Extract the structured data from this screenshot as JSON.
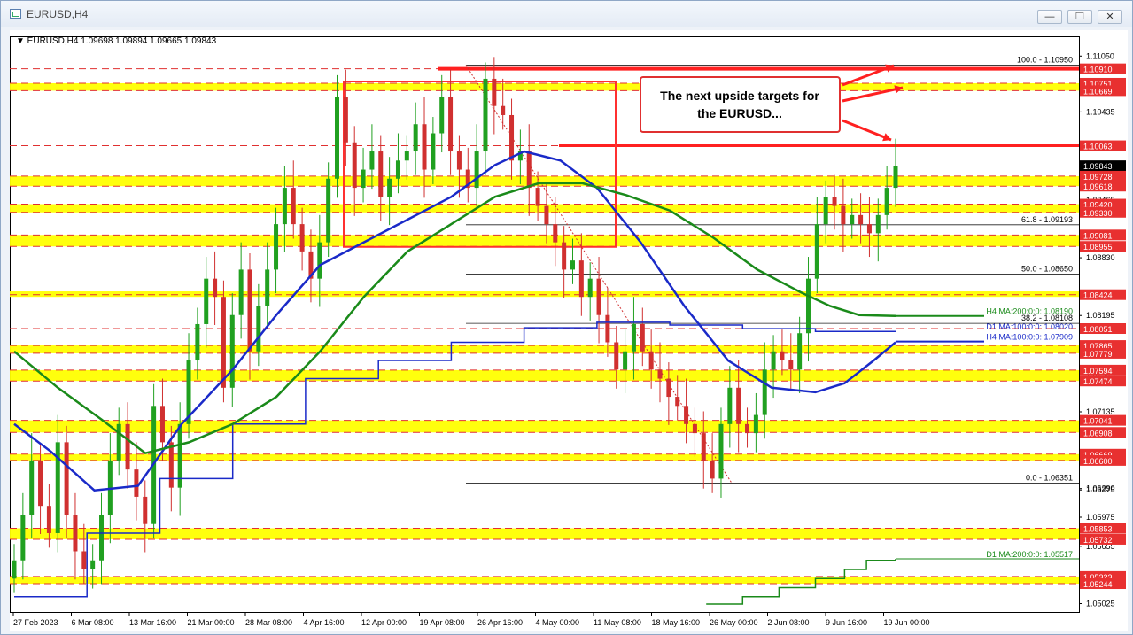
{
  "window": {
    "title": "EURUSD,H4",
    "controls": {
      "minimize": "—",
      "restore": "❐",
      "close": "✕"
    }
  },
  "chart_info": "EURUSD,H4  1.09698 1.09894 1.09665 1.09843",
  "annotation": {
    "line1": "The next upside targets for",
    "line2": "the EURUSD..."
  },
  "colors": {
    "bull": "#20a020",
    "bear": "#d03030",
    "ma100": "#1a2ac8",
    "ma200": "#1a8a1a",
    "d1ma100": "#1a2ac8",
    "d1ma200": "#1a8a1a",
    "zone": "#ffff00",
    "box": "#ff3030",
    "price_label": "#e83030"
  },
  "chart_data": {
    "type": "candlestick",
    "symbol": "EURUSD",
    "timeframe": "H4",
    "ohlc_last": {
      "open": 1.09698,
      "high": 1.09894,
      "low": 1.09665,
      "close": 1.09843
    },
    "ylim": [
      1.0502,
      1.1116
    ],
    "y_ticks": [
      "1.11050",
      "1.10435",
      "1.09845",
      "1.09465",
      "1.08830",
      "1.08195",
      "1.07545",
      "1.06275",
      "1.05975",
      "1.05655",
      "1.05025",
      "1.05290",
      "1.10045",
      "1.07135",
      "1.06290"
    ],
    "x_ticks": [
      "27 Feb 2023",
      "6 Mar 08:00",
      "13 Mar 16:00",
      "21 Mar 00:00",
      "28 Mar 08:00",
      "4 Apr 16:00",
      "12 Apr 00:00",
      "19 Apr 08:00",
      "26 Apr 16:00",
      "4 May 00:00",
      "11 May 08:00",
      "18 May 16:00",
      "26 May 00:00",
      "2 Jun 08:00",
      "9 Jun 16:00",
      "19 Jun 00:00"
    ],
    "price_labels": [
      {
        "text": "1.10910",
        "y": 1.1091,
        "style": "red"
      },
      {
        "text": "1.10751",
        "y": 1.10751,
        "style": "red"
      },
      {
        "text": "1.10669",
        "y": 1.10669,
        "style": "red"
      },
      {
        "text": "1.10063",
        "y": 1.10063,
        "style": "red"
      },
      {
        "text": "1.09843",
        "y": 1.09843,
        "style": "black"
      },
      {
        "text": "1.09728",
        "y": 1.09728,
        "style": "red"
      },
      {
        "text": "1.09618",
        "y": 1.09618,
        "style": "red"
      },
      {
        "text": "1.09420",
        "y": 1.0942,
        "style": "red"
      },
      {
        "text": "1.09330",
        "y": 1.0933,
        "style": "red"
      },
      {
        "text": "1.09081",
        "y": 1.09081,
        "style": "red"
      },
      {
        "text": "1.08955",
        "y": 1.08955,
        "style": "red"
      },
      {
        "text": "1.08424",
        "y": 1.08424,
        "style": "red"
      },
      {
        "text": "1.08051",
        "y": 1.08051,
        "style": "red"
      },
      {
        "text": "1.07865",
        "y": 1.07865,
        "style": "red"
      },
      {
        "text": "1.07779",
        "y": 1.07779,
        "style": "red"
      },
      {
        "text": "1.07594",
        "y": 1.07594,
        "style": "red"
      },
      {
        "text": "1.07474",
        "y": 1.07474,
        "style": "red"
      },
      {
        "text": "1.07041",
        "y": 1.07041,
        "style": "red"
      },
      {
        "text": "1.06908",
        "y": 1.06908,
        "style": "red"
      },
      {
        "text": "1.06669",
        "y": 1.06669,
        "style": "red"
      },
      {
        "text": "1.06600",
        "y": 1.066,
        "style": "red"
      },
      {
        "text": "1.05853",
        "y": 1.05853,
        "style": "red"
      },
      {
        "text": "1.05732",
        "y": 1.05732,
        "style": "red"
      },
      {
        "text": "1.05323",
        "y": 1.05323,
        "style": "red"
      },
      {
        "text": "1.05244",
        "y": 1.05244,
        "style": "red"
      }
    ],
    "fib_labels": [
      {
        "text": "100.0 - 1.10950",
        "y": 1.1095
      },
      {
        "text": "61.8 - 1.09193",
        "y": 1.09193
      },
      {
        "text": "50.0 - 1.08650",
        "y": 1.0865
      },
      {
        "text": "38.2 - 1.08108",
        "y": 1.08108
      },
      {
        "text": "0.0 - 1.06351",
        "y": 1.06351
      }
    ],
    "ma_labels": [
      {
        "text": "H4 MA:200:0:0: 1.08190",
        "y": 1.0819,
        "color": "green"
      },
      {
        "text": "D1 MA:100:0:0: 1.08020",
        "y": 1.0802,
        "color": "blue"
      },
      {
        "text": "H4 MA:100:0:0: 1.07909",
        "y": 1.07909,
        "color": "blue"
      },
      {
        "text": "D1 MA:200:0:0: 1.05517",
        "y": 1.05517,
        "color": "green"
      }
    ],
    "zones": [
      {
        "lo": 1.10669,
        "hi": 1.10751
      },
      {
        "lo": 1.09618,
        "hi": 1.09728
      },
      {
        "lo": 1.0933,
        "hi": 1.0942
      },
      {
        "lo": 1.08955,
        "hi": 1.09081
      },
      {
        "lo": 1.084,
        "hi": 1.0846
      },
      {
        "lo": 1.07779,
        "hi": 1.07865
      },
      {
        "lo": 1.07474,
        "hi": 1.07594
      },
      {
        "lo": 1.06908,
        "hi": 1.07041
      },
      {
        "lo": 1.066,
        "hi": 1.06669
      },
      {
        "lo": 1.05732,
        "hi": 1.05853
      },
      {
        "lo": 1.05244,
        "hi": 1.05323
      }
    ],
    "box": {
      "x_from": "10 Apr",
      "x_to": "9 May",
      "lo": 1.0895,
      "hi": 1.1077
    },
    "ma_h4_100": [
      [
        0,
        1.07
      ],
      [
        5,
        1.067
      ],
      [
        11,
        1.0627
      ],
      [
        17,
        1.0632
      ],
      [
        23,
        1.07
      ],
      [
        30,
        1.076
      ],
      [
        36,
        1.082
      ],
      [
        42,
        1.0875
      ],
      [
        48,
        1.09
      ],
      [
        54,
        1.0925
      ],
      [
        60,
        1.095
      ],
      [
        66,
        1.0985
      ],
      [
        70,
        1.1
      ],
      [
        75,
        1.099
      ],
      [
        80,
        1.096
      ],
      [
        86,
        1.09
      ],
      [
        92,
        1.083
      ],
      [
        98,
        1.077
      ],
      [
        104,
        1.074
      ],
      [
        110,
        1.0735
      ],
      [
        114,
        1.0745
      ],
      [
        118,
        1.077
      ],
      [
        121,
        1.079
      ]
    ],
    "ma_h4_200": [
      [
        0,
        1.078
      ],
      [
        6,
        1.074
      ],
      [
        12,
        1.0705
      ],
      [
        18,
        1.0668
      ],
      [
        24,
        1.068
      ],
      [
        30,
        1.07
      ],
      [
        36,
        1.073
      ],
      [
        42,
        1.078
      ],
      [
        48,
        1.084
      ],
      [
        54,
        1.089
      ],
      [
        60,
        1.092
      ],
      [
        66,
        1.095
      ],
      [
        72,
        1.0965
      ],
      [
        78,
        1.0965
      ],
      [
        84,
        1.0952
      ],
      [
        90,
        1.0935
      ],
      [
        96,
        1.0905
      ],
      [
        102,
        1.087
      ],
      [
        108,
        1.0845
      ],
      [
        112,
        1.083
      ],
      [
        116,
        1.082
      ],
      [
        121,
        1.0819
      ]
    ],
    "ma_d1_100": [
      [
        0,
        1.051
      ],
      [
        10,
        1.058
      ],
      [
        20,
        1.064
      ],
      [
        30,
        1.07
      ],
      [
        40,
        1.075
      ],
      [
        50,
        1.077
      ],
      [
        60,
        1.079
      ],
      [
        70,
        1.0806
      ],
      [
        80,
        1.0812
      ],
      [
        90,
        1.0809
      ],
      [
        100,
        1.0805
      ],
      [
        110,
        1.0802
      ],
      [
        121,
        1.0802
      ]
    ],
    "ma_d1_200": [
      [
        95,
        1.0502
      ],
      [
        100,
        1.051
      ],
      [
        105,
        1.052
      ],
      [
        110,
        1.053
      ],
      [
        114,
        1.054
      ],
      [
        117,
        1.055
      ],
      [
        121,
        1.05517
      ]
    ],
    "closes": [
      1.055,
      1.06,
      1.066,
      1.061,
      1.058,
      1.068,
      1.06,
      1.056,
      1.054,
      1.055,
      1.06,
      1.066,
      1.07,
      1.065,
      1.062,
      1.059,
      1.072,
      1.068,
      1.063,
      1.07,
      1.077,
      1.081,
      1.086,
      1.084,
      1.074,
      1.082,
      1.087,
      1.078,
      1.083,
      1.087,
      1.092,
      1.096,
      1.092,
      1.089,
      1.086,
      1.09,
      1.097,
      1.106,
      1.101,
      1.096,
      1.098,
      1.1,
      1.095,
      1.097,
      1.099,
      1.1,
      1.103,
      1.098,
      1.102,
      1.106,
      1.1,
      1.098,
      1.096,
      1.1,
      1.108,
      1.105,
      1.104,
      1.099,
      1.1,
      1.096,
      1.094,
      1.092,
      1.09,
      1.087,
      1.088,
      1.084,
      1.086,
      1.082,
      1.079,
      1.076,
      1.078,
      1.081,
      1.078,
      1.076,
      1.075,
      1.073,
      1.072,
      1.07,
      1.069,
      1.066,
      1.064,
      1.07,
      1.074,
      1.07,
      1.069,
      1.071,
      1.076,
      1.078,
      1.077,
      1.076,
      1.08,
      1.086,
      1.092,
      1.095,
      1.094,
      1.092,
      1.093,
      1.092,
      1.091,
      1.093,
      1.096,
      1.0984
    ]
  }
}
